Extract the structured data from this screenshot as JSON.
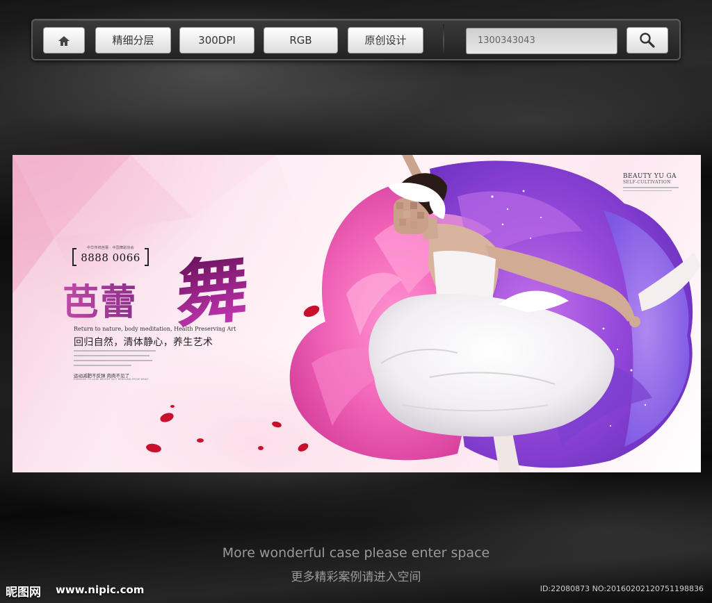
{
  "toolbar": {
    "home_icon": "home-icon",
    "buttons": [
      {
        "label": "精细分层"
      },
      {
        "label": "300DPI"
      },
      {
        "label": "RGB"
      },
      {
        "label": "原创设计"
      }
    ],
    "search_value": "1300343043",
    "search_icon": "magnifier-icon"
  },
  "banner": {
    "phone_small_line": "中华传统芭蕾 · 中国舞蹈协会",
    "phone_number": "8888 0066",
    "title_main": "芭蕾",
    "title_brush": "舞",
    "subtitle_en": "Return to nature, body meditation, Health Preserving Art",
    "subtitle_cn": "回归自然，清体静心，养生艺术",
    "slogan_cn": "运动减肥不反弹 肉肉不见了",
    "slogan_en": "EXERCISE TO LOSE WEIGHT NOT REBOUND FROM WHAT",
    "corner_line1": "BEAUTY YU GA",
    "corner_line2": "SELF-CULTIVATION",
    "colors": {
      "pink": "#f06ab4",
      "purple": "#8a3fd6",
      "petal_red": "#c8102e"
    }
  },
  "footer": {
    "line_en": "More wonderful case please enter space",
    "line_cn": "更多精彩案例请进入空间"
  },
  "watermark": {
    "logo": "昵图网",
    "url": "www.nipic.com",
    "id": "ID:22080873 NO:20160202120751198836"
  }
}
